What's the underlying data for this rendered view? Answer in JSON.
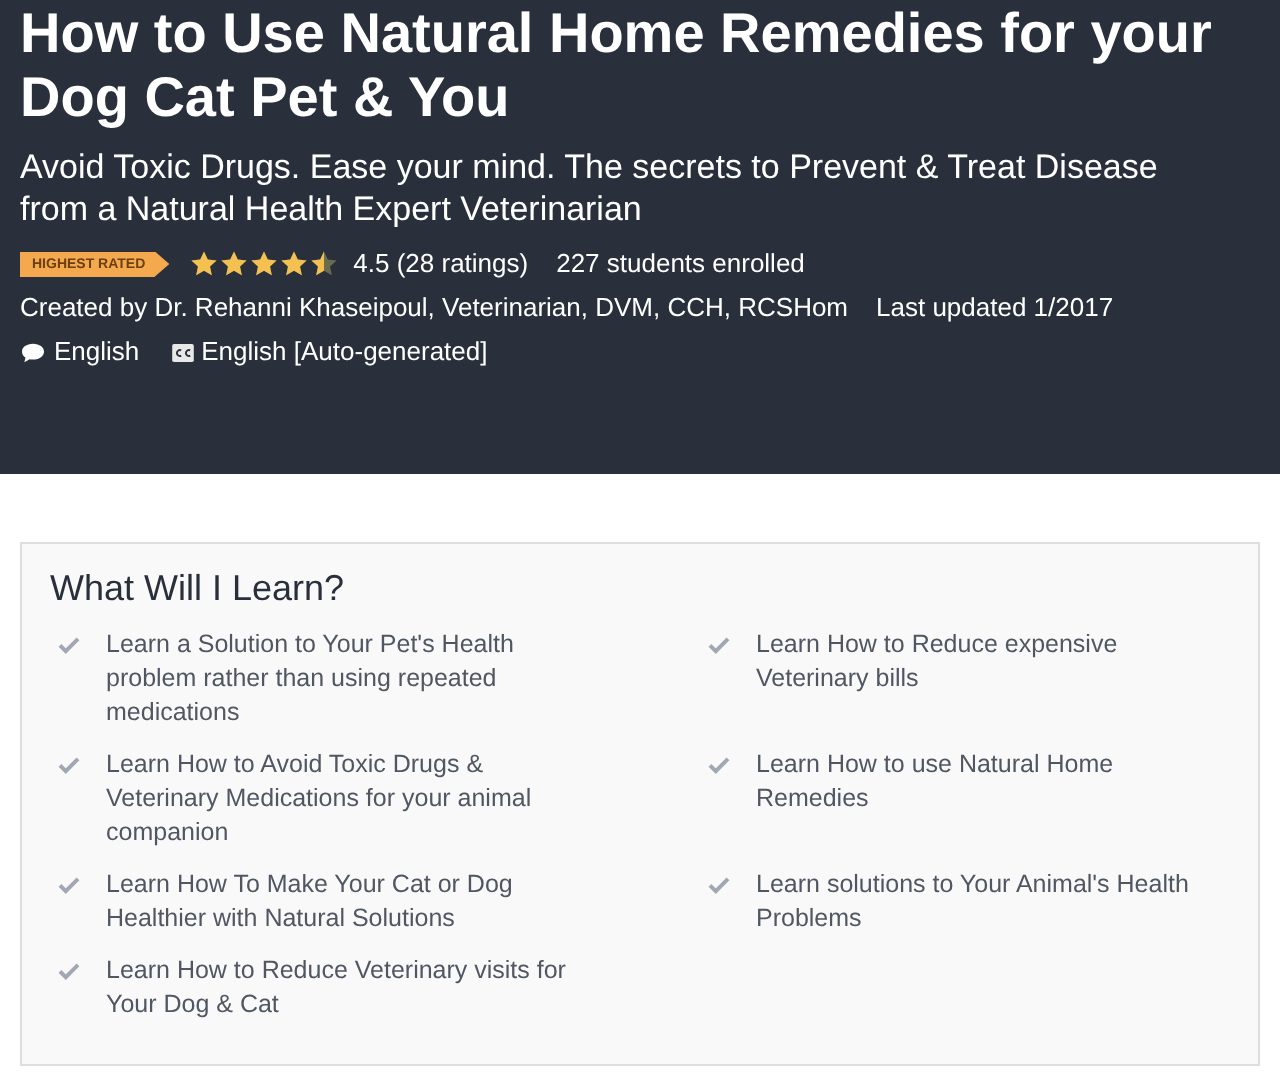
{
  "course": {
    "title": "How to Use Natural Home Remedies for your Dog Cat Pet & You",
    "subtitle": "Avoid Toxic Drugs. Ease your mind. The secrets to Prevent & Treat Disease from a Natural Health Expert Veterinarian",
    "badge": "HIGHEST RATED",
    "stars": 4.5,
    "rating": "4.5 (28 ratings)",
    "enrolled": "227 students enrolled",
    "created_by": "Created by Dr. Rehanni Khaseipoul, Veterinarian, DVM, CCH, RCSHom",
    "last_updated": "Last updated 1/2017",
    "language": "English",
    "captions": "English [Auto-generated]"
  },
  "learn": {
    "heading": "What Will I Learn?",
    "items": [
      "Learn a Solution to Your Pet's Health problem rather than using repeated medications",
      "Learn How to Reduce expensive Veterinary bills",
      "Learn How to Avoid Toxic Drugs & Veterinary Medications for your animal companion",
      "Learn How to use Natural Home Remedies",
      "Learn How To Make Your Cat or Dog Healthier with Natural Solutions",
      "Learn solutions to Your Animal's Health Problems",
      "Learn How to Reduce Veterinary visits for Your Dog & Cat"
    ]
  }
}
